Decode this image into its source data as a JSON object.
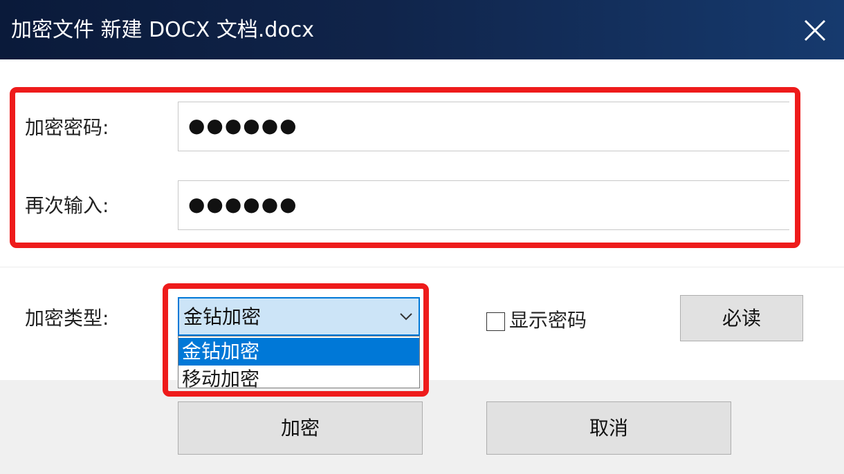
{
  "window": {
    "title": "加密文件 新建 DOCX 文档.docx",
    "close_icon": "close-icon"
  },
  "password": {
    "label": "加密密码:",
    "masked_value": "●●●●●●"
  },
  "confirm": {
    "label": "再次输入:",
    "masked_value": "●●●●●●"
  },
  "encrypt_type": {
    "label": "加密类型:",
    "selected": "金钻加密",
    "options": [
      "金钻加密",
      "移动加密"
    ],
    "arrow_icon": "chevron-down-icon"
  },
  "show_password": {
    "label": "显示密码",
    "checked": false
  },
  "buttons": {
    "readme": "必读",
    "encrypt": "加密",
    "cancel": "取消"
  },
  "colors": {
    "highlight": "#ee1b1b",
    "accent": "#0078d7",
    "titlebar": "#0a1a3a"
  }
}
